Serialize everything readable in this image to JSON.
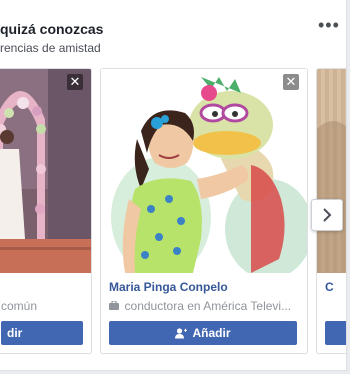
{
  "header": {
    "title": "quizá conozcas",
    "subtitle": "rencias de amistad",
    "more_label": "•••"
  },
  "cards": [
    {
      "name": "",
      "subtitle": "común",
      "button_label": "dir"
    },
    {
      "name": "Maria Pinga Conpelo",
      "subtitle_occupation": "conductora",
      "subtitle_connector": "en",
      "subtitle_org": "América Televi...",
      "button_label": "Añadir"
    },
    {
      "name": "C",
      "subtitle": "",
      "button_label": ""
    }
  ],
  "icons": {
    "close": "close-icon",
    "next": "chevron-right-icon",
    "add_friend": "add-friend-icon",
    "briefcase": "briefcase-icon"
  },
  "colors": {
    "link": "#365899",
    "button": "#4267b2",
    "muted": "#90949c",
    "text": "#1d2129"
  }
}
